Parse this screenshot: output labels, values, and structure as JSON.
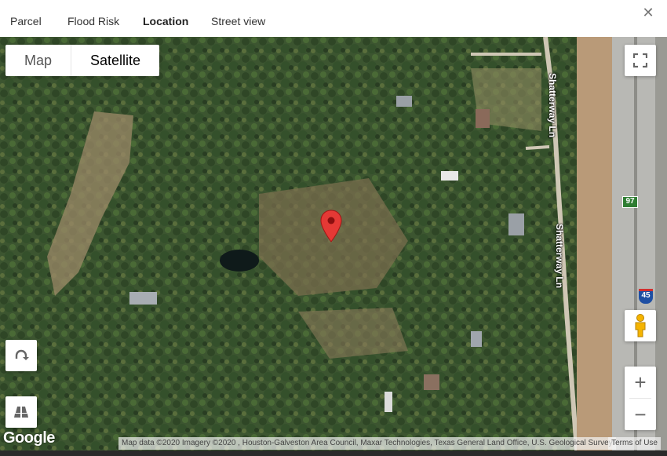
{
  "tabs": [
    {
      "label": "Parcel",
      "active": false
    },
    {
      "label": "Flood Risk",
      "active": false
    },
    {
      "label": "Location",
      "active": true
    },
    {
      "label": "Street view",
      "active": false
    }
  ],
  "close_icon": "close-icon",
  "map": {
    "type_buttons": [
      "Map",
      "Satellite"
    ],
    "selected_type": "Satellite",
    "street_labels": [
      "Shatterway Ln",
      "Shatterway Ln"
    ],
    "highway_shields": [
      "97",
      "45"
    ],
    "logo": "Google",
    "attribution": "Map data ©2020 Imagery ©2020 , Houston-Galveston Area Council, Maxar Technologies, Texas General Land Office, U.S. Geological Survey",
    "terms": "Terms of Use",
    "zoom_in": "+",
    "zoom_out": "−",
    "colors": {
      "marker": "#e53935",
      "highway_shield": "#2e7d32",
      "interstate_shield": "#1e4fa3"
    }
  }
}
